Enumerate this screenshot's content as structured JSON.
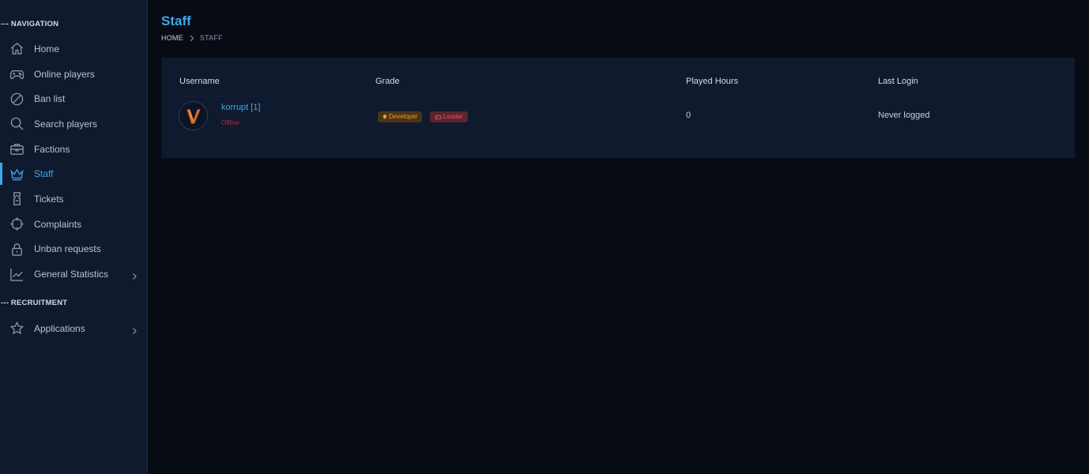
{
  "sidebar": {
    "navigation_title": "--- NAVIGATION",
    "recruitment_title": "--- RECRUITMENT",
    "items": [
      {
        "label": "Home",
        "icon": "home-icon"
      },
      {
        "label": "Online players",
        "icon": "gamepad-icon"
      },
      {
        "label": "Ban list",
        "icon": "ban-icon"
      },
      {
        "label": "Search players",
        "icon": "search-icon"
      },
      {
        "label": "Factions",
        "icon": "briefcase-icon"
      },
      {
        "label": "Staff",
        "icon": "crown-icon",
        "active": true
      },
      {
        "label": "Tickets",
        "icon": "ticket-icon"
      },
      {
        "label": "Complaints",
        "icon": "crosshair-icon"
      },
      {
        "label": "Unban requests",
        "icon": "lock-icon"
      },
      {
        "label": "General Statistics",
        "icon": "chart-line-icon",
        "has_submenu": true
      }
    ],
    "recruitment_items": [
      {
        "label": "Applications",
        "icon": "star-icon",
        "has_submenu": true
      }
    ]
  },
  "page": {
    "title": "Staff",
    "breadcrumb": {
      "home": "HOME",
      "current": "STAFF"
    }
  },
  "table": {
    "columns": [
      "Username",
      "Grade",
      "Played Hours",
      "Last Login"
    ],
    "rows": [
      {
        "username": "korrupt [1]",
        "status": "Offline",
        "grades": [
          "Developer",
          "Leader"
        ],
        "played_hours": "0",
        "last_login": "Never logged"
      }
    ]
  },
  "colors": {
    "accent": "#3ea7e6",
    "sidebar_bg": "#0f1a2e",
    "page_bg": "#070b14",
    "offline": "#b02a33",
    "developer_badge": "#e89a3c",
    "leader_badge": "#e0556a"
  }
}
